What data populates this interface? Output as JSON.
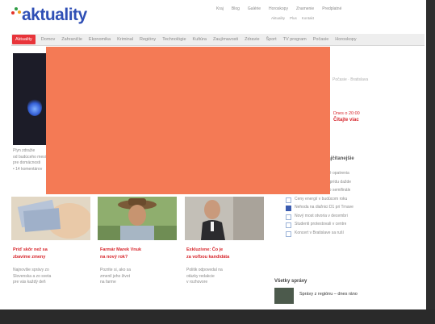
{
  "site": {
    "logo_text": "aktuality"
  },
  "header": {
    "top_links": [
      "Kraj",
      "Blog",
      "Galérie",
      "Horoskopy",
      "Znamenie",
      "Predplatné"
    ],
    "sub_links": [
      "Aktuality",
      "Plus",
      "Kontakt"
    ]
  },
  "menu": [
    "Aktuality",
    "Domov",
    "Zahraničie",
    "Ekonomika",
    "Kriminal",
    "Regióny",
    "Technológie",
    "Kultúra",
    "Zaujímavosti",
    "Zdravie",
    "Šport",
    "TV program",
    "Počasie",
    "Horoskopy"
  ],
  "main_story": {
    "lines": [
      "Plyn zdražie",
      "od budúceho mesiaca",
      "pre domácnosti",
      "• 14 komentárov"
    ]
  },
  "cards": [
    {
      "title": [
        "Príď skôr než sa",
        "zbavíme zmeny"
      ],
      "summary": [
        "Najnovšie správy zo",
        "Slovenska a zo sveta",
        "pre vás každý deň"
      ]
    },
    {
      "title": [
        "Farmár Marek Vnuk",
        "na nový rok?"
      ],
      "summary": [
        "Pozrite si, ako sa",
        "zmenil jeho život",
        "na farme"
      ]
    },
    {
      "title": [
        "Exkluzívne: Čo je",
        "za voľbou kandidáta"
      ],
      "summary": [
        "Politik odpovedal na",
        "otázky redakcie",
        "v rozhovore"
      ]
    }
  ],
  "sidebar": {
    "faint_text": "Počasie · Bratislava",
    "promo_label": "Dnes o 20:00",
    "promo_title": "Čítajte viac",
    "section_title": "Najčítanejšie",
    "items": [
      {
        "text": "Vláda schválila nové opatrenia",
        "filled": false
      },
      {
        "text": "Počasie na víkend: prídu dažde",
        "filled": false
      },
      {
        "text": "Hokejisti postúpili do semifinále",
        "filled": false
      },
      {
        "text": "Ceny energií v budúcom roku",
        "filled": false
      },
      {
        "text": "Nehoda na diaľnici D1 pri Trnave",
        "filled": true
      },
      {
        "text": "Nový most otvoria v decembri",
        "filled": false
      },
      {
        "text": "Študenti protestovali v centre",
        "filled": false
      },
      {
        "text": "Koncert v Bratislave sa ruší",
        "filled": false
      }
    ]
  },
  "latest": {
    "heading": "Všetky správy",
    "item": "Správy z regiónu – dnes ráno"
  },
  "colors": {
    "logo_blue": "#2f4fb5",
    "accent_red": "#d7262c",
    "overlay_orange": "#f47a55",
    "menu_active": "#e8343a"
  }
}
